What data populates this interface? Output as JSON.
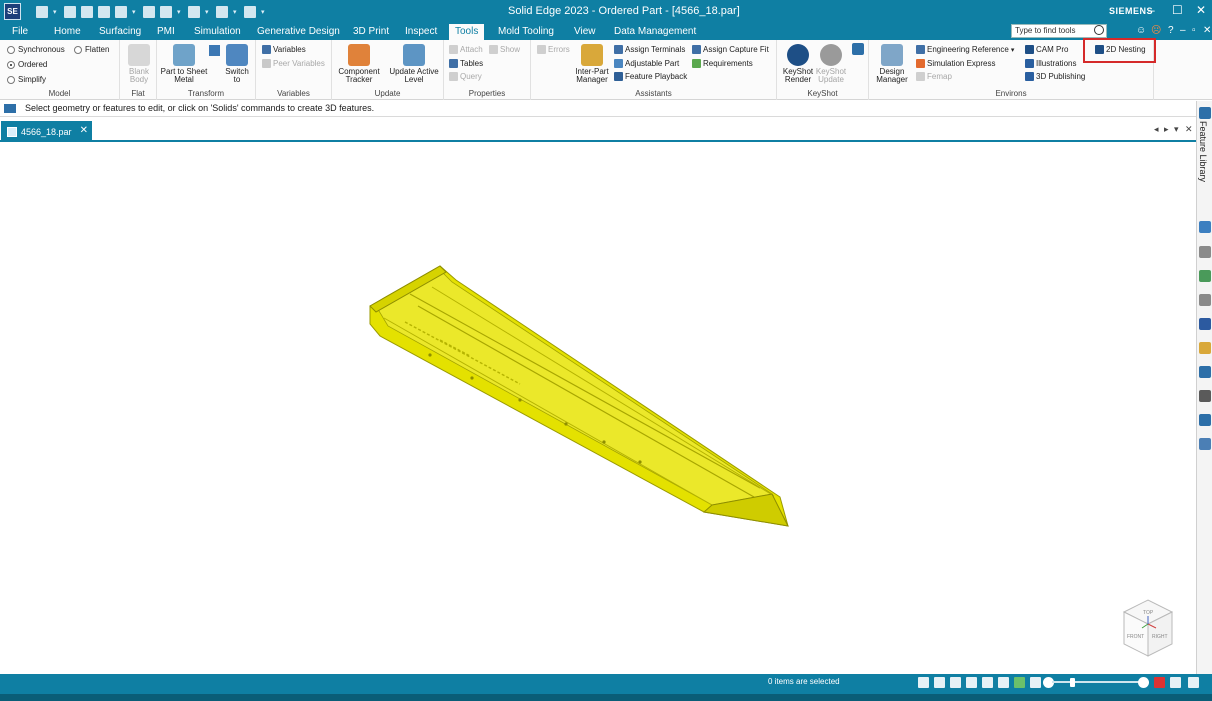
{
  "app": {
    "logo_text": "SE",
    "window_title": "Solid Edge 2023 - Ordered Part - [4566_18.par]",
    "brand": "SIEMENS"
  },
  "menu": {
    "tabs": [
      {
        "label": "File",
        "active": false
      },
      {
        "label": "Home",
        "active": false
      },
      {
        "label": "Surfacing",
        "active": false
      },
      {
        "label": "PMI",
        "active": false
      },
      {
        "label": "Simulation",
        "active": false
      },
      {
        "label": "Generative Design",
        "active": false
      },
      {
        "label": "3D Print",
        "active": false
      },
      {
        "label": "Inspect",
        "active": false
      },
      {
        "label": "Tools",
        "active": true
      },
      {
        "label": "Mold Tooling",
        "active": false
      },
      {
        "label": "View",
        "active": false
      },
      {
        "label": "Data Management",
        "active": false
      }
    ],
    "search_placeholder": "Type to find tools"
  },
  "ribbon": {
    "model": {
      "label": "Model",
      "synchronous": "Synchronous",
      "flatten": "Flatten",
      "ordered": "Ordered",
      "simplify": "Simplify",
      "selected": "Ordered"
    },
    "flat": {
      "label": "Flat",
      "blank_body": "Blank Body"
    },
    "transform": {
      "label": "Transform",
      "part_to_sheet": "Part to Sheet Metal",
      "switch_to": "Switch to"
    },
    "variables": {
      "label": "Variables",
      "variables": "Variables",
      "peer_variables": "Peer Variables"
    },
    "update": {
      "label": "Update",
      "component_tracker": "Component Tracker",
      "update_active_level": "Update Active Level"
    },
    "properties": {
      "label": "Properties",
      "attach": "Attach",
      "show": "Show",
      "tables": "Tables",
      "query": "Query"
    },
    "assistants": {
      "label": "Assistants",
      "errors": "Errors",
      "inter_part": "Inter-Part Manager",
      "assign_terminals": "Assign Terminals",
      "adjustable_part": "Adjustable Part",
      "feature_playback": "Feature Playback",
      "assign_capture_fit": "Assign Capture Fit",
      "requirements": "Requirements"
    },
    "keyshot": {
      "label": "KeyShot",
      "render": "KeyShot Render",
      "update": "KeyShot Update"
    },
    "environs": {
      "label": "Environs",
      "design_manager": "Design Manager",
      "engineering_reference": "Engineering Reference",
      "simulation_express": "Simulation Express",
      "femap": "Femap",
      "cam_pro": "CAM Pro",
      "illustrations": "Illustrations",
      "publishing": "3D Publishing",
      "nesting_2d": "2D Nesting"
    }
  },
  "prompt": "Select geometry or features to edit, or click on 'Solids' commands to create 3D features.",
  "document_tab": "4566_18.par",
  "right_pane": {
    "feature_library": "Feature Library"
  },
  "viewcube": {
    "front": "FRONT",
    "right": "RIGHT",
    "top": "TOP"
  },
  "status": {
    "selection": "0 items are selected"
  },
  "colors": {
    "accent": "#0f7fa3",
    "part": "#e4e100",
    "part_edge": "#9a9a00",
    "highlight": "#d52a2a"
  }
}
